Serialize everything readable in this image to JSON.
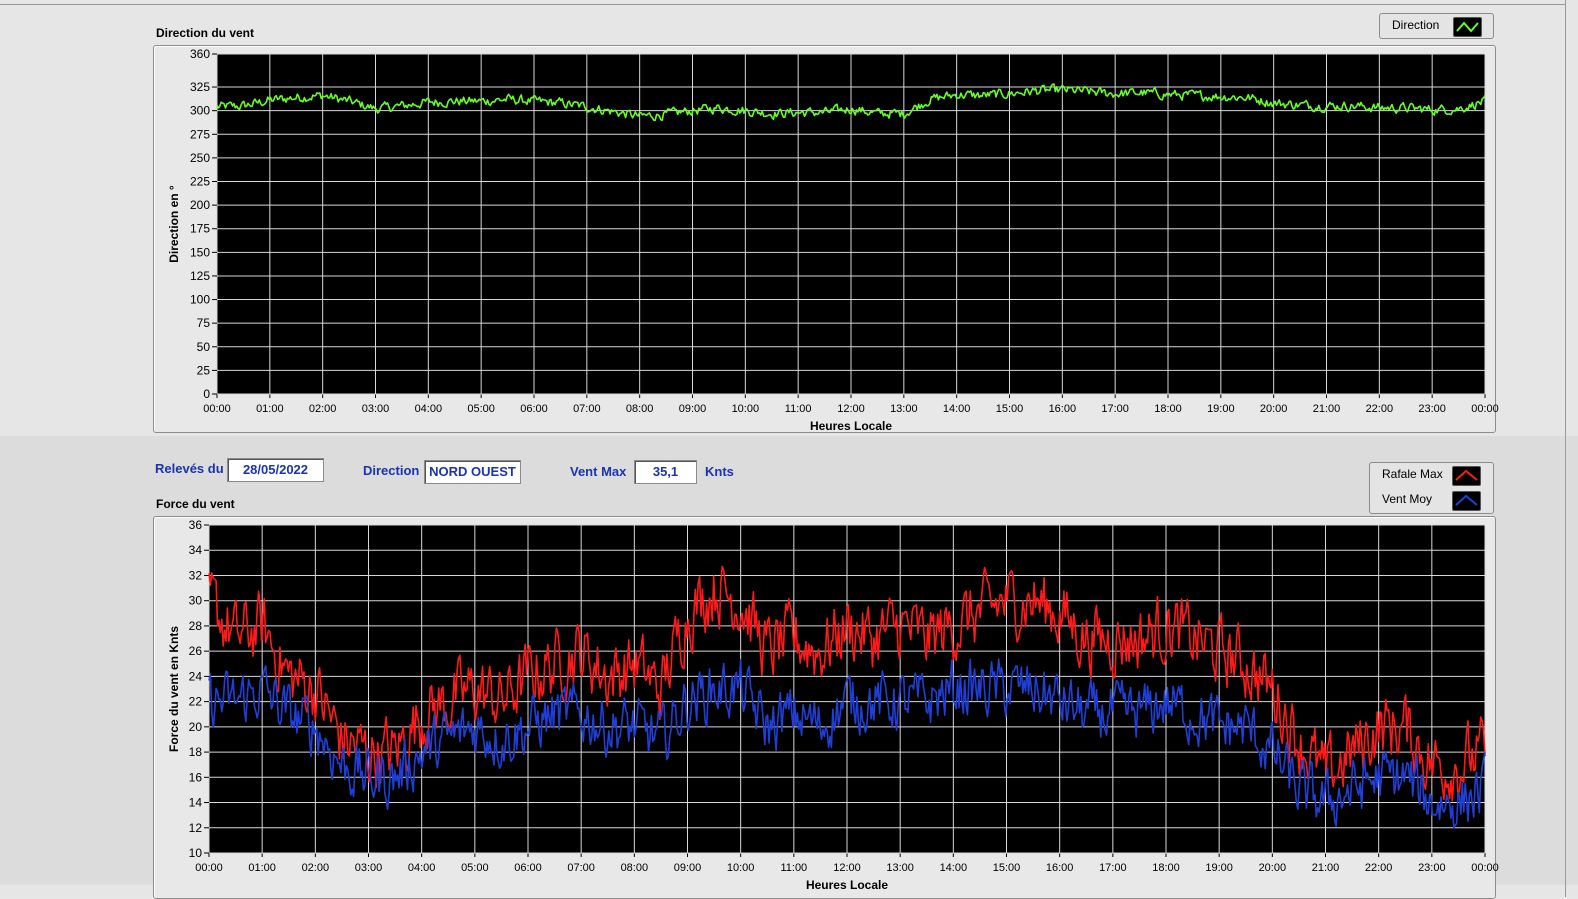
{
  "colors": {
    "plot_bg": "#000000",
    "grid": "#d8d8d8",
    "direction": "#66ff22",
    "rafale": "#ff1a1a",
    "vent_moy": "#1f3fd6",
    "label_blue": "#1a33b3"
  },
  "info": {
    "releves_label": "Relevés du",
    "releves_value": "28/05/2022",
    "direction_label": "Direction",
    "direction_value": "NORD OUEST",
    "ventmax_label": "Vent Max",
    "ventmax_value": "35,1",
    "ventmax_unit": "Knts"
  },
  "chart_data": [
    {
      "type": "line",
      "title": "Direction du vent",
      "xlabel": "Heures Locale",
      "ylabel": "Direction en °",
      "xlim": [
        0,
        24
      ],
      "ylim": [
        0,
        360
      ],
      "yticks": [
        0,
        25,
        50,
        75,
        100,
        125,
        150,
        175,
        200,
        225,
        250,
        275,
        300,
        325,
        360
      ],
      "xticks": [
        "00:00",
        "01:00",
        "02:00",
        "03:00",
        "04:00",
        "05:00",
        "06:00",
        "07:00",
        "08:00",
        "09:00",
        "10:00",
        "11:00",
        "12:00",
        "13:00",
        "14:00",
        "15:00",
        "16:00",
        "17:00",
        "18:00",
        "19:00",
        "20:00",
        "21:00",
        "22:00",
        "23:00",
        "00:00"
      ],
      "grid": true,
      "legend": "top-right",
      "series": [
        {
          "name": "Direction",
          "color": "#66ff22",
          "x": [
            0,
            0.5,
            1,
            1.5,
            2,
            2.5,
            3,
            3.5,
            4,
            4.5,
            5,
            5.5,
            6,
            6.5,
            7,
            7.5,
            8,
            8.5,
            9,
            9.5,
            10,
            10.5,
            11,
            11.5,
            12,
            12.5,
            13,
            13.5,
            14,
            14.5,
            15,
            15.5,
            16,
            16.5,
            17,
            17.5,
            18,
            18.5,
            19,
            19.5,
            20,
            20.5,
            21,
            21.5,
            22,
            22.5,
            23,
            23.5,
            24
          ],
          "values": [
            304,
            305,
            311,
            314,
            316,
            310,
            302,
            305,
            309,
            310,
            310,
            312,
            310,
            308,
            304,
            299,
            294,
            296,
            300,
            303,
            300,
            297,
            298,
            298,
            302,
            297,
            297,
            312,
            317,
            316,
            318,
            321,
            322,
            320,
            318,
            319,
            317,
            316,
            315,
            314,
            308,
            306,
            305,
            305,
            303,
            303,
            301,
            302,
            310
          ]
        }
      ]
    },
    {
      "type": "line",
      "title": "Force du vent",
      "xlabel": "Heures Locale",
      "ylabel": "Force du vent en Knts",
      "xlim": [
        0,
        24
      ],
      "ylim": [
        10,
        36
      ],
      "yticks": [
        10,
        12,
        14,
        16,
        18,
        20,
        22,
        24,
        26,
        28,
        30,
        32,
        34,
        36
      ],
      "xticks": [
        "00:00",
        "01:00",
        "02:00",
        "03:00",
        "04:00",
        "05:00",
        "06:00",
        "07:00",
        "08:00",
        "09:00",
        "10:00",
        "11:00",
        "12:00",
        "13:00",
        "14:00",
        "15:00",
        "16:00",
        "17:00",
        "18:00",
        "19:00",
        "20:00",
        "21:00",
        "22:00",
        "23:00",
        "00:00"
      ],
      "grid": true,
      "legend": "top-right",
      "series": [
        {
          "name": "Rafale Max",
          "color": "#ff1a1a",
          "x": [
            0,
            0.5,
            1,
            1.5,
            2,
            2.5,
            3,
            3.5,
            4,
            4.5,
            5,
            5.5,
            6,
            6.5,
            7,
            7.5,
            8,
            8.5,
            9,
            9.5,
            10,
            10.5,
            11,
            11.5,
            12,
            12.5,
            13,
            13.5,
            14,
            14.5,
            15,
            15.5,
            16,
            16.5,
            17,
            17.5,
            18,
            18.5,
            19,
            19.5,
            20,
            20.5,
            21,
            21.5,
            22,
            22.5,
            23,
            23.5,
            24
          ],
          "values": [
            30,
            27,
            28,
            24,
            23,
            19,
            18,
            18,
            21,
            22,
            23,
            22,
            24,
            25,
            26,
            24,
            25,
            23,
            29,
            31,
            30,
            26,
            27,
            26,
            28,
            27,
            28,
            27,
            28,
            29,
            30,
            30,
            29,
            27,
            27,
            27,
            28,
            27,
            26,
            25,
            23,
            19,
            16,
            18,
            20,
            20,
            17,
            17,
            18
          ]
        },
        {
          "name": "Vent Moy",
          "color": "#1f3fd6",
          "x": [
            0,
            0.5,
            1,
            1.5,
            2,
            2.5,
            3,
            3.5,
            4,
            4.5,
            5,
            5.5,
            6,
            6.5,
            7,
            7.5,
            8,
            8.5,
            9,
            9.5,
            10,
            10.5,
            11,
            11.5,
            12,
            12.5,
            13,
            13.5,
            14,
            14.5,
            15,
            15.5,
            16,
            16.5,
            17,
            17.5,
            18,
            18.5,
            19,
            19.5,
            20,
            20.5,
            21,
            21.5,
            22,
            22.5,
            23,
            23.5,
            24
          ],
          "values": [
            22,
            22,
            23,
            21,
            20,
            17,
            16,
            16,
            18,
            19,
            20,
            19,
            20,
            21,
            21,
            20,
            20,
            19,
            22,
            23,
            23,
            20,
            21,
            20,
            22,
            22,
            22,
            22,
            23,
            23,
            23,
            23,
            22,
            21,
            21,
            21,
            22,
            21,
            20,
            20,
            18,
            15,
            14,
            15,
            16,
            16,
            14,
            14,
            15
          ]
        }
      ]
    }
  ]
}
